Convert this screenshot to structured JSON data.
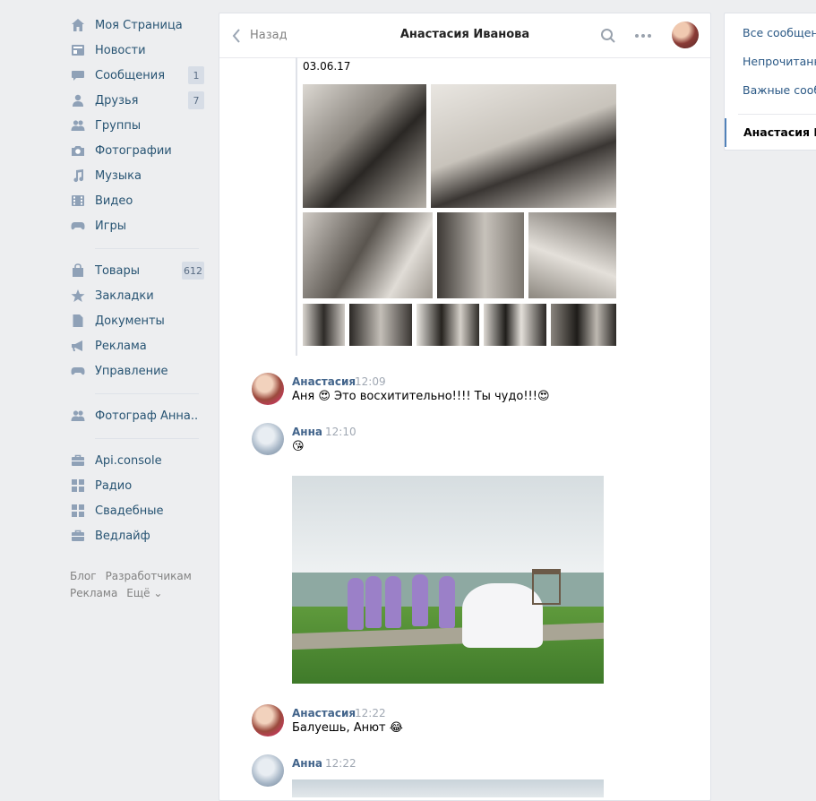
{
  "nav": {
    "items": [
      {
        "label": "Моя Страница",
        "icon": "home-icon"
      },
      {
        "label": "Новости",
        "icon": "news-icon"
      },
      {
        "label": "Сообщения",
        "icon": "messages-icon",
        "badge": "1"
      },
      {
        "label": "Друзья",
        "icon": "friends-icon",
        "badge": "7"
      },
      {
        "label": "Группы",
        "icon": "groups-icon"
      },
      {
        "label": "Фотографии",
        "icon": "camera-icon"
      },
      {
        "label": "Музыка",
        "icon": "music-icon"
      },
      {
        "label": "Видео",
        "icon": "video-icon"
      },
      {
        "label": "Игры",
        "icon": "gamepad-icon"
      }
    ],
    "items2": [
      {
        "label": "Товары",
        "icon": "shop-bag-icon",
        "badge": "612"
      },
      {
        "label": "Закладки",
        "icon": "star-icon"
      },
      {
        "label": "Документы",
        "icon": "document-icon"
      },
      {
        "label": "Реклама",
        "icon": "megaphone-icon"
      },
      {
        "label": "Управление",
        "icon": "gamepad-icon"
      }
    ],
    "items3": [
      {
        "label": "Фотограф Анна..",
        "icon": "groups-icon"
      }
    ],
    "items4": [
      {
        "label": "Api.console",
        "icon": "briefcase-icon"
      },
      {
        "label": "Радио",
        "icon": "apps-grid-icon"
      },
      {
        "label": "Свадебные",
        "icon": "apps-grid-icon"
      },
      {
        "label": "Ведлайф",
        "icon": "briefcase-icon"
      }
    ],
    "footer": {
      "blog": "Блог",
      "developers": "Разработчикам",
      "ads": "Реклама",
      "more": "Ещё ⌄"
    }
  },
  "chat": {
    "back_label": "Назад",
    "title": "Анастасия Иванова",
    "forward_date": "03.06.17",
    "messages": [
      {
        "name": "Анастасия",
        "time": "12:09",
        "text": "Аня 😍 Это восхитительно!!!! Ты чудо!!!😍"
      },
      {
        "name": "Анна",
        "time": "12:10",
        "text": "😘"
      },
      {
        "name": "Анастасия",
        "time": "12:22",
        "text": "Балуешь, Анют 😂"
      },
      {
        "name": "Анна",
        "time": "12:22",
        "text": ""
      }
    ]
  },
  "right_panel": {
    "all": "Все сообщения",
    "unread": "Непрочитанные",
    "important": "Важные сообщения",
    "active_chat": "Анастасия Иванова"
  }
}
